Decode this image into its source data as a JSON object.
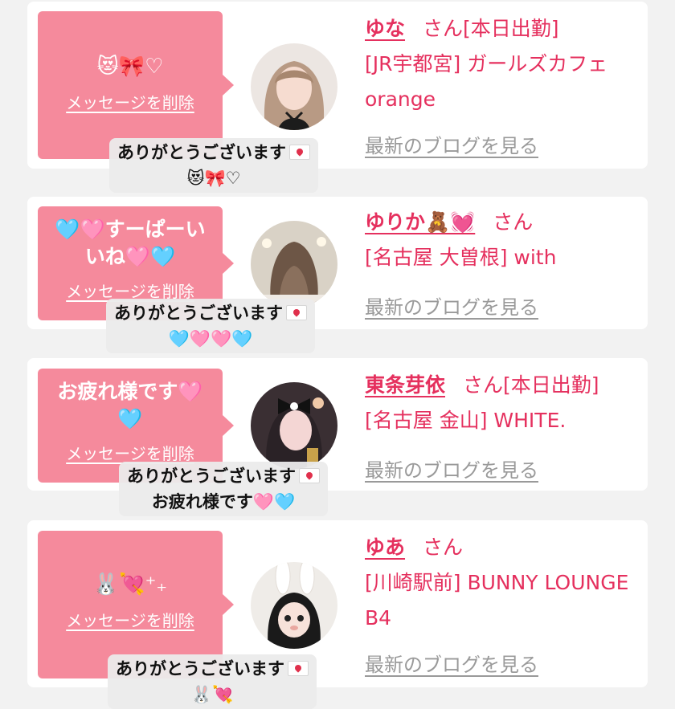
{
  "colors": {
    "page_bg": "#f2f2f2",
    "bubble_bg": "#f58a9c",
    "accent": "#e5305e",
    "link_gray": "#9a9a9a"
  },
  "entries": [
    {
      "message": "😻🎀♡",
      "delete_label": "メッセージを削除",
      "avatar": "avatar-girl-blonde-hair",
      "name": "ゆな",
      "san": "さん[本日出勤]",
      "shop": "[JR宇都宮] ガールズカフェorange",
      "blog": "最新のブログを見る",
      "caption_line1": "ありがとうございます",
      "caption_line2": "😻🎀♡"
    },
    {
      "message": "🩵🩷すーぱーいいね🩷🩵",
      "delete_label": "メッセージを削除",
      "avatar": "avatar-long-wavy-hair",
      "name": "ゆりか🧸💓",
      "san": "さん",
      "shop": "[名古屋 大曽根] with",
      "blog": "最新のブログを見る",
      "caption_line1": "ありがとうございます",
      "caption_line2": "🩵🩷🩷🩵"
    },
    {
      "message": "お疲れ様です🩷🩵",
      "delete_label": "メッセージを削除",
      "avatar": "avatar-girl-bow-thumbs-up",
      "name": "東条芽依",
      "san": "さん[本日出勤]",
      "shop": "[名古屋 金山] WHITE.",
      "blog": "最新のブログを見る",
      "caption_line1": "ありがとうございます",
      "caption_line2": "お疲れ様です🩷🩵"
    },
    {
      "message": "🐰💘⁺₊",
      "delete_label": "メッセージを削除",
      "avatar": "avatar-bunny-ears",
      "name": "ゆあ",
      "san": "さん",
      "shop": "[川崎駅前] BUNNY LOUNGE B4",
      "blog": "最新のブログを見る",
      "caption_line1": "ありがとうございます",
      "caption_line2": "🐰💘"
    }
  ]
}
